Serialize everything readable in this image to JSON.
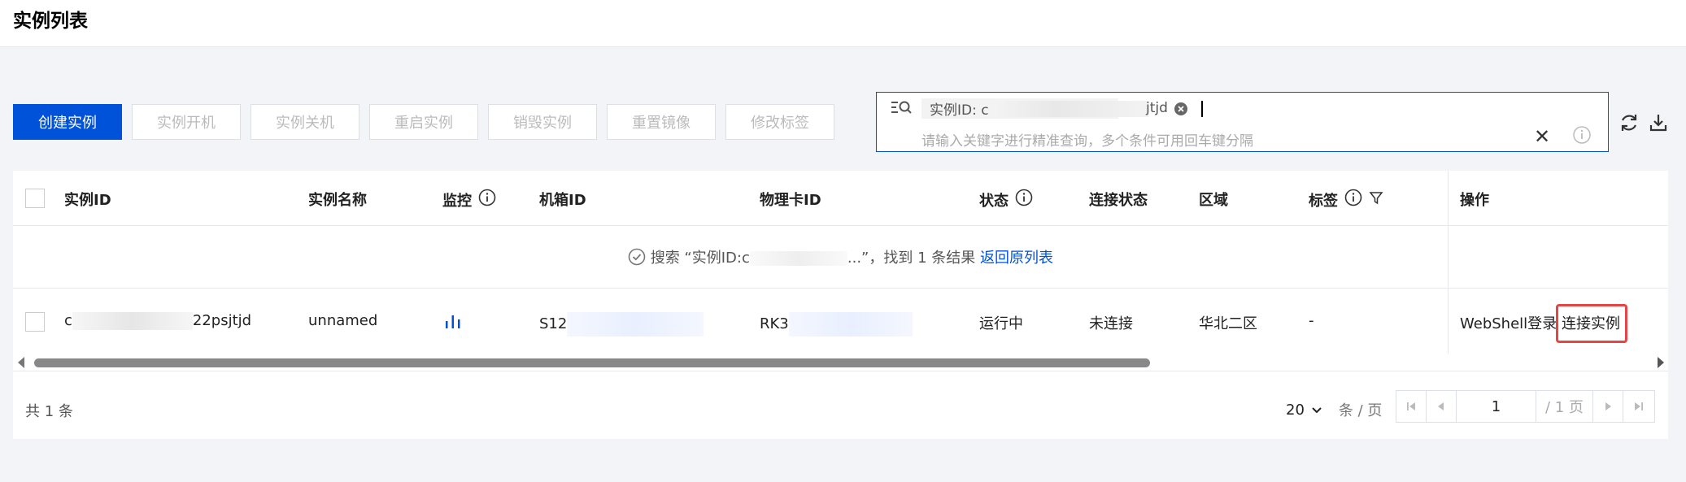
{
  "page": {
    "title": "实例列表"
  },
  "toolbar": {
    "buttons": [
      {
        "label": "创建实例",
        "primary": true
      },
      {
        "label": "实例开机",
        "primary": false
      },
      {
        "label": "实例关机",
        "primary": false
      },
      {
        "label": "重启实例",
        "primary": false
      },
      {
        "label": "销毁实例",
        "primary": false
      },
      {
        "label": "重置镜像",
        "primary": false
      },
      {
        "label": "修改标签",
        "primary": false
      }
    ]
  },
  "search": {
    "tag_prefix": "实例ID: c",
    "tag_suffix": "jtjd",
    "placeholder": "请输入关键字进行精准查询，多个条件可用回车键分隔"
  },
  "table": {
    "headers": {
      "instance_id": "实例ID",
      "instance_name": "实例名称",
      "monitor": "监控",
      "chassis_id": "机箱ID",
      "card_id": "物理卡ID",
      "status": "状态",
      "connection": "连接状态",
      "region": "区域",
      "tags": "标签",
      "actions": "操作"
    },
    "search_result": {
      "prefix": "搜索 “实例ID:c",
      "suffix": "...”，找到 1 条结果",
      "back_link": "返回原列表"
    },
    "row": {
      "id_prefix": "c",
      "id_suffix": "22psjtjd",
      "name": "unnamed",
      "chassis_id": "S12",
      "card_id": "RK3",
      "status": "运行中",
      "connection": "未连接",
      "region": "华北二区",
      "tags": "-",
      "action_webshell": "WebShell登录",
      "action_connect": "连接实例"
    }
  },
  "footer": {
    "total": "共 1 条",
    "page_size": "20",
    "page_size_unit": "条 / 页",
    "current_page": "1",
    "total_pages": "/ 1 页"
  },
  "colors": {
    "primary": "#0052d9",
    "highlight": "#e54545"
  }
}
